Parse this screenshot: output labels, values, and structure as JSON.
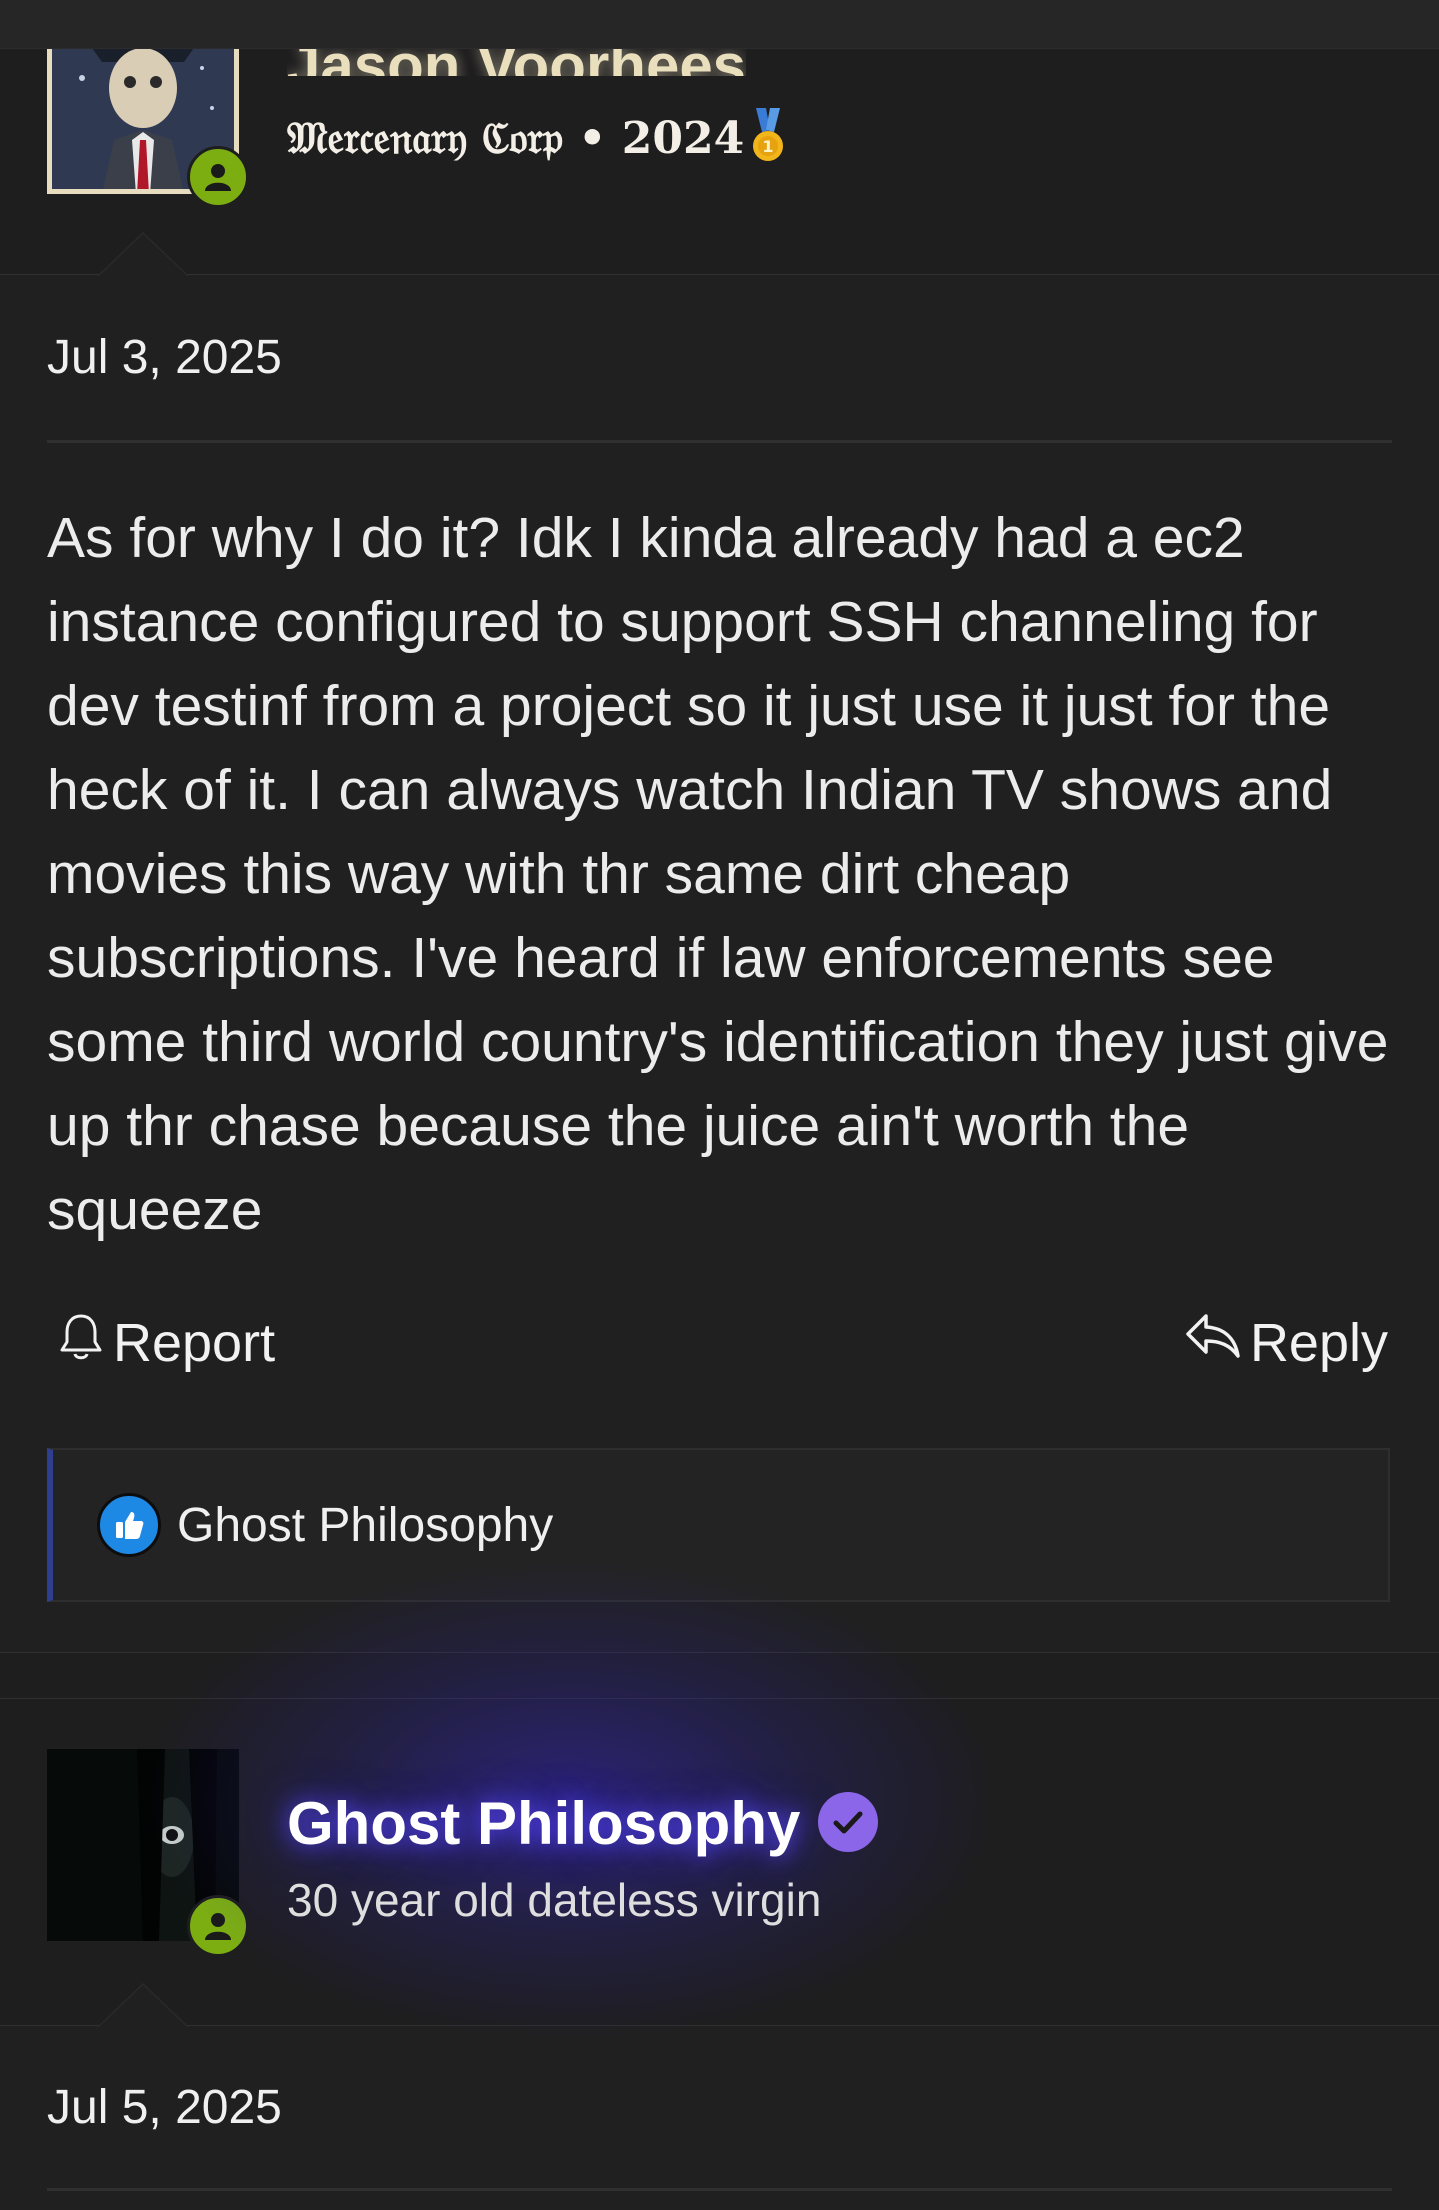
{
  "post1": {
    "username": "Jason Voorhees",
    "user_title": "𝔐𝔢𝔯𝔠𝔢𝔫𝔞𝔯𝔶 ℭ𝔬𝔯𝔭 • 2024",
    "medal_icon": "gold-medal-icon",
    "date": "Jul 3, 2025",
    "body": "As for why I do it? Idk I kinda already had a ec2 instance configured to support SSH channeling for dev testinf from a project so it just use it just for the heck of it. I can always watch Indian TV shows and movies this way with thr same dirt cheap subscriptions. I've heard if law enforcements see some third world country's identification they just give up thr chase because the juice ain't worth the squeeze",
    "actions": {
      "report_label": "Report",
      "reply_label": "Reply"
    },
    "reactions": {
      "icon": "thumbs-up-icon",
      "users": "Ghost Philosophy"
    }
  },
  "post2": {
    "username": "Ghost Philosophy",
    "user_title": "30 year old dateless virgin",
    "date": "Jul 5, 2025"
  },
  "colors": {
    "background": "#202021",
    "online": "#7cae12",
    "verified": "#8c66e8",
    "like": "#1e88e5",
    "name_glow": "#4b3cff"
  }
}
